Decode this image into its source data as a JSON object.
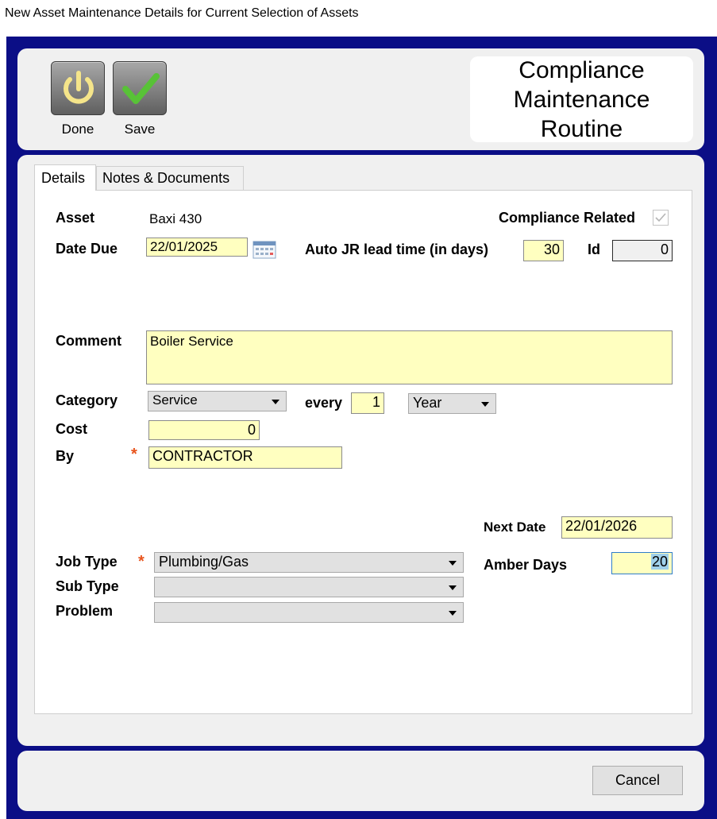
{
  "window": {
    "title": "New Asset Maintenance Details for Current Selection of Assets"
  },
  "toolbar": {
    "done_label": "Done",
    "save_label": "Save",
    "done_icon": "power-icon",
    "save_icon": "checkmark-icon",
    "routine_title": "Compliance Maintenance Routine"
  },
  "tabs": [
    {
      "label": "Details",
      "active": true
    },
    {
      "label": "Notes & Documents",
      "active": false
    }
  ],
  "form": {
    "asset_label": "Asset",
    "asset_value": "Baxi 430",
    "compliance_label": "Compliance Related",
    "compliance_checked": true,
    "date_due_label": "Date Due",
    "date_due_value": "22/01/2025",
    "lead_time_label": "Auto JR lead time (in days)",
    "lead_time_value": "30",
    "id_label": "Id",
    "id_value": "0",
    "comment_label": "Comment",
    "comment_value": "Boiler Service",
    "category_label": "Category",
    "category_value": "Service",
    "every_label": "every",
    "every_value": "1",
    "period_value": "Year",
    "cost_label": "Cost",
    "cost_value": "0",
    "by_label": "By",
    "by_value": "CONTRACTOR",
    "next_date_label": "Next Date",
    "next_date_value": "22/01/2026",
    "job_type_label": "Job Type",
    "job_type_value": "Plumbing/Gas",
    "amber_days_label": "Amber Days",
    "amber_days_value": "20",
    "sub_type_label": "Sub Type",
    "sub_type_value": "",
    "problem_label": "Problem",
    "problem_value": "",
    "required_marker": "*"
  },
  "footer": {
    "cancel_label": "Cancel"
  },
  "colors": {
    "frame": "#0b0e86",
    "field": "#ffffc0",
    "required": "#e8541d"
  }
}
